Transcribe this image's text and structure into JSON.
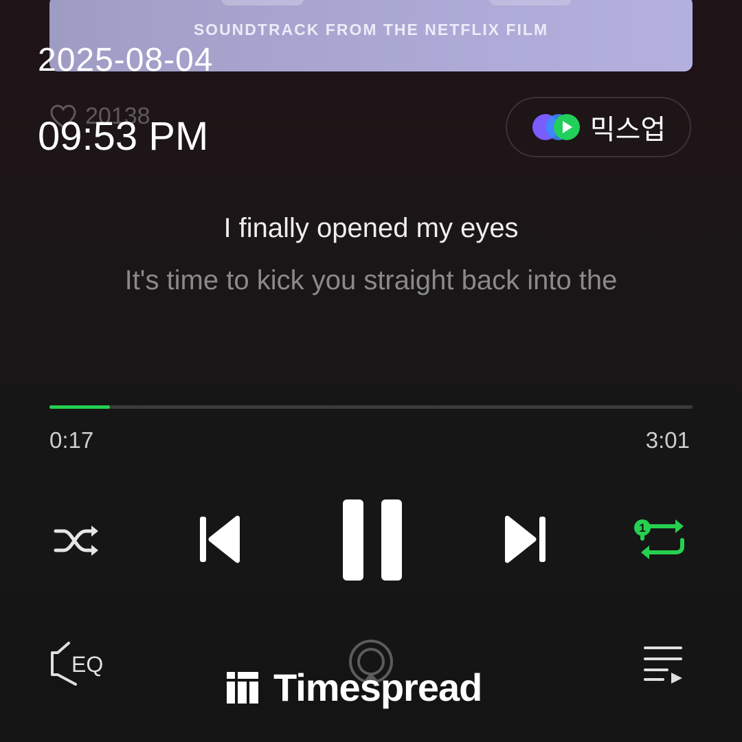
{
  "album": {
    "subtitle": "SOUNDTRACK FROM THE NETFLIX FILM"
  },
  "overlay": {
    "date": "2025-08-04",
    "time": "09:53 PM"
  },
  "like": {
    "icon": "heart-icon",
    "count": "20138"
  },
  "mixup": {
    "label": "믹스업",
    "icon": "mixup-logo-icon",
    "colors": {
      "purple": "#7b5cff",
      "blue": "#3a8bff",
      "green": "#20d05a"
    }
  },
  "lyrics": {
    "current": "I finally opened my eyes",
    "next": "It's time to kick you straight back into the"
  },
  "playback": {
    "elapsed": "0:17",
    "total": "3:01",
    "progress_fraction": 0.094,
    "state": "playing",
    "repeat_mode": "1",
    "accent_color": "#25d04f"
  },
  "controls": {
    "shuffle_icon": "shuffle-icon",
    "prev_icon": "skip-previous-icon",
    "pause_icon": "pause-icon",
    "next_icon": "skip-next-icon",
    "repeat_icon": "repeat-one-icon",
    "eq_label": "EQ",
    "cast_icon": "cast-icon",
    "queue_icon": "playlist-icon"
  },
  "watermark": {
    "text": "Timespread",
    "icon": "timespread-logo-icon"
  }
}
